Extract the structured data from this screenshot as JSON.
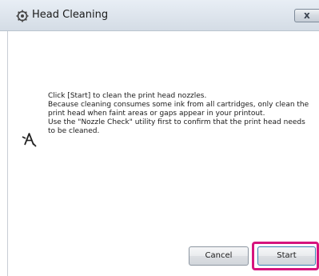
{
  "window": {
    "title": "Head Cleaning",
    "close_label": "x"
  },
  "message": {
    "lines": [
      "Click [Start] to clean the print head nozzles.",
      "Because cleaning consumes some ink from all cartridges, only clean the",
      "print head when faint areas or gaps appear in your printout.",
      "Use the \"Nozzle Check\" utility first to confirm that the print head needs",
      "to be cleaned."
    ]
  },
  "buttons": {
    "cancel_label": "Cancel",
    "start_label": "Start"
  },
  "colors": {
    "highlight": "#d6147e",
    "titlebar": "#dfe6ee"
  },
  "icons": {
    "app": "printer-gear-icon",
    "content": "print-head-cursor-icon",
    "close": "close-icon"
  }
}
